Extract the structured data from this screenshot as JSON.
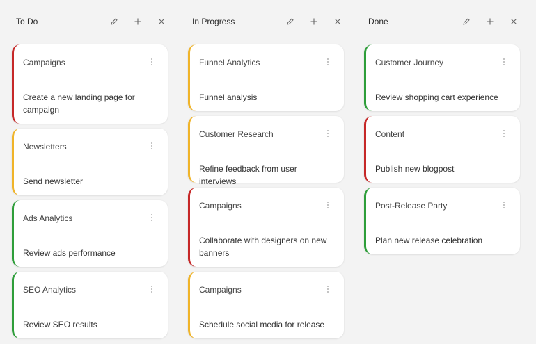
{
  "columns": [
    {
      "title": "To Do",
      "cards": [
        {
          "category": "Campaigns",
          "text": "Create a new landing page for campaign",
          "priority_color": "#c62828"
        },
        {
          "category": "Newsletters",
          "text": "Send newsletter",
          "priority_color": "#f0b429"
        },
        {
          "category": "Ads Analytics",
          "text": "Review ads performance",
          "priority_color": "#2e9e3a"
        },
        {
          "category": "SEO Analytics",
          "text": "Review SEO results",
          "priority_color": "#2e9e3a"
        }
      ]
    },
    {
      "title": "In Progress",
      "cards": [
        {
          "category": "Funnel Analytics",
          "text": "Funnel analysis",
          "priority_color": "#f0b429"
        },
        {
          "category": "Customer Research",
          "text": "Refine feedback from user interviews",
          "priority_color": "#f0b429"
        },
        {
          "category": "Campaigns",
          "text": "Collaborate with designers on new banners",
          "priority_color": "#c62828"
        },
        {
          "category": "Campaigns",
          "text": "Schedule social media for release",
          "priority_color": "#f0b429"
        }
      ]
    },
    {
      "title": "Done",
      "cards": [
        {
          "category": "Customer Journey",
          "text": "Review shopping cart experience",
          "priority_color": "#2e9e3a"
        },
        {
          "category": "Content",
          "text": "Publish new blogpost",
          "priority_color": "#c62828"
        },
        {
          "category": "Post-Release Party",
          "text": "Plan new release celebration",
          "priority_color": "#2e9e3a"
        }
      ]
    }
  ],
  "icons": {
    "edit": "pencil-icon",
    "add": "plus-icon",
    "remove": "close-icon",
    "card_menu": "more-vertical-icon"
  }
}
